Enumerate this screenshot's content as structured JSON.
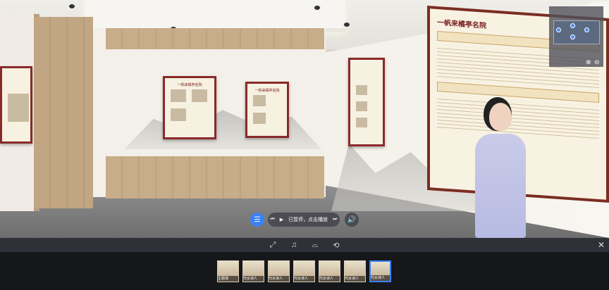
{
  "playback": {
    "status_label": "已暂停，点击播放",
    "prev_icon": "prev-track-icon",
    "play_icon": "play-icon",
    "next_icon": "next-track-icon",
    "sound_icon": "speaker-icon",
    "playlist_icon": "playlist-icon"
  },
  "exhibit": {
    "main_title": "一帆来橘亭名院",
    "small_titles": [
      "一帆来橘亭名院",
      "一帆来橘亭名院"
    ]
  },
  "toolbar": {
    "items": [
      {
        "icon": "fullscreen-icon",
        "glyph": "⤢"
      },
      {
        "icon": "music-icon",
        "glyph": "♫"
      },
      {
        "icon": "vr-glasses-icon",
        "glyph": "⌓"
      },
      {
        "icon": "gyroscope-icon",
        "glyph": "⟲"
      }
    ],
    "close_glyph": "✕"
  },
  "thumbnails": [
    {
      "label": "主题墙"
    },
    {
      "label": "代女诗人"
    },
    {
      "label": "代女诗人"
    },
    {
      "label": "代女诗人"
    },
    {
      "label": "代女诗人"
    },
    {
      "label": "代女诗人"
    },
    {
      "label": "代女诗人",
      "active": true
    }
  ],
  "minimap": {
    "zoom_in_glyph": "⊕",
    "zoom_out_glyph": "⊖"
  },
  "colors": {
    "accent": "#3b82f6",
    "poster_frame": "#7b2d22"
  }
}
